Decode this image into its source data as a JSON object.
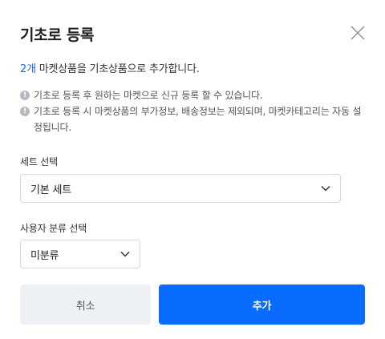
{
  "dialog": {
    "title": "기초로 등록",
    "summary_count": "2개",
    "summary_text": " 마켓상품을 기초상품으로 추가합니다.",
    "notes": [
      "기초로 등록 후 원하는 마켓으로 신규 등록 할 수 있습니다.",
      "기초로 등록 시 마켓상품의 부가정보, 배송정보는 제외되며, 마켓카테고리는 자동 설정됩니다."
    ],
    "set_label": "세트 선택",
    "set_value": "기본 세트",
    "category_label": "사용자 분류 선택",
    "category_value": "미분류",
    "cancel_label": "취소",
    "add_label": "추가"
  },
  "colors": {
    "accent": "#0a6cff",
    "count_text": "#1a66e8",
    "cancel_bg": "#edf0f4",
    "note_icon": "#b4b9c2"
  },
  "icons": {
    "close": "close-icon",
    "info": "info-icon",
    "dropdown": "chevron-down-icon"
  }
}
